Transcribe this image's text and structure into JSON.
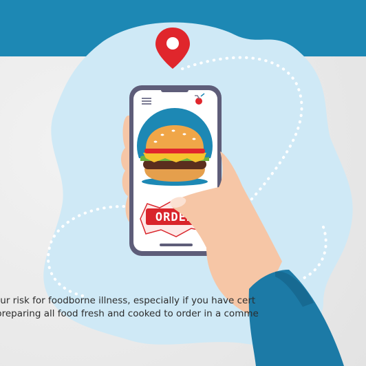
{
  "illustration": {
    "order_button_label": "ORDER",
    "caption_lines": [
      "our risk for foodborne illness, especially if you have cert",
      "preparing all food fresh and cooked to order in a comme"
    ]
  },
  "colors": {
    "band": "#1d88b4",
    "blob": "#cfe9f6",
    "pin": "#e0262c",
    "phone_frame": "#5e5d79",
    "order_red": "#d9242b",
    "skin": "#f6c6a6",
    "sleeve": "#1c7aa6"
  },
  "icons": [
    "location-pin-icon",
    "menu-icon",
    "cart-icon"
  ]
}
